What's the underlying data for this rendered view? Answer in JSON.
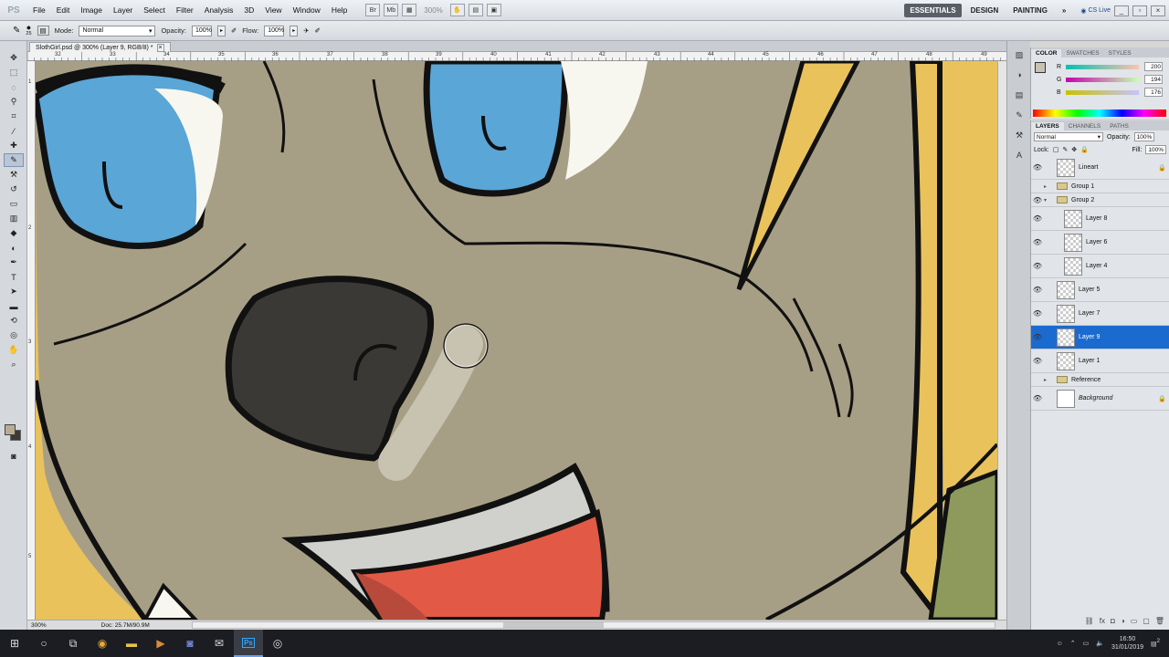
{
  "app": {
    "logo": "PS"
  },
  "menu": [
    "File",
    "Edit",
    "Image",
    "Layer",
    "Select",
    "Filter",
    "Analysis",
    "3D",
    "View",
    "Window",
    "Help"
  ],
  "menubar_tools": {
    "br": "Br",
    "mb": "Mb",
    "zoom": "300%"
  },
  "workspaces": {
    "items": [
      "ESSENTIALS",
      "DESIGN",
      "PAINTING"
    ],
    "more": "»",
    "cslive": "CS Live"
  },
  "window_controls": {
    "minimize": "_",
    "restore": "▫",
    "close": "×"
  },
  "options": {
    "brush_size": "25",
    "mode_label": "Mode:",
    "mode_value": "Normal",
    "opacity_label": "Opacity:",
    "opacity_value": "100%",
    "flow_label": "Flow:",
    "flow_value": "100%"
  },
  "document": {
    "tab_title": "SlothGirl.psd @ 300% (Layer 9, RGB/8) *",
    "tab_close": "×",
    "zoom_status": "300%",
    "doc_status": "Doc: 25.7M/90.9M",
    "ruler_ticks": [
      "32",
      "33",
      "34",
      "35",
      "36",
      "37",
      "38",
      "39",
      "40",
      "41",
      "42",
      "43",
      "44",
      "45",
      "46",
      "47",
      "48",
      "49"
    ],
    "ruler_left": [
      "1",
      "2",
      "3",
      "4",
      "5"
    ]
  },
  "color_panel": {
    "tabs": [
      "COLOR",
      "SWATCHES",
      "STYLES"
    ],
    "r_label": "R",
    "r_value": "200",
    "g_label": "G",
    "g_value": "194",
    "b_label": "B",
    "b_value": "176"
  },
  "layers_panel": {
    "tabs": [
      "LAYERS",
      "CHANNELS",
      "PATHS"
    ],
    "blend_mode": "Normal",
    "opacity_label": "Opacity:",
    "opacity_value": "100%",
    "lock_label": "Lock:",
    "fill_label": "Fill:",
    "fill_value": "100%",
    "layers": [
      {
        "name": "Lineart"
      },
      {
        "name": "Group 1"
      },
      {
        "name": "Group 2"
      },
      {
        "name": "Layer 8"
      },
      {
        "name": "Layer 6"
      },
      {
        "name": "Layer 4"
      },
      {
        "name": "Layer 5"
      },
      {
        "name": "Layer 7"
      },
      {
        "name": "Layer 9"
      },
      {
        "name": "Layer 1"
      },
      {
        "name": "Reference"
      },
      {
        "name": "Background"
      }
    ]
  },
  "taskbar": {
    "time": "16:50",
    "date": "31/01/2019",
    "notifications": "2"
  }
}
